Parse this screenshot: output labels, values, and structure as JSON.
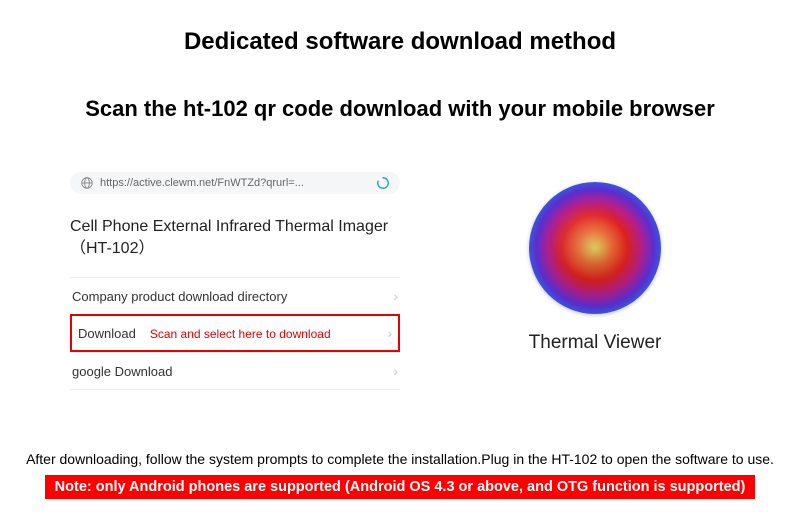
{
  "title": "Dedicated software download method",
  "subtitle": "Scan the ht-102 qr code download with your mobile browser",
  "phone": {
    "url": "https://active.clewm.net/FnWTZd?qrurl=...",
    "product_name": "Cell Phone External Infrared Thermal Imager（HT-102）",
    "menu": {
      "item0": "Company product download directory",
      "item1_label": "Download",
      "item1_note": "Scan and select here to download",
      "item2": "google Download"
    }
  },
  "app": {
    "name": "Thermal Viewer"
  },
  "footer": {
    "text": "After downloading, follow the system prompts to complete the installation.Plug in the HT-102 to open the software to use.",
    "note": "Note: only Android phones are supported (Android OS 4.3 or above, and OTG function is supported)"
  }
}
